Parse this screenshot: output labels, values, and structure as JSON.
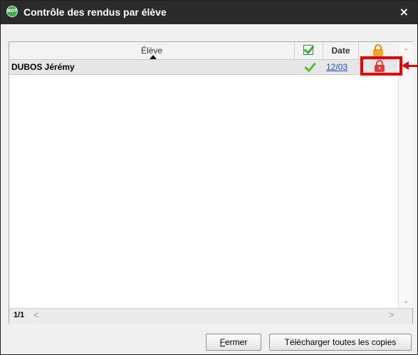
{
  "window": {
    "app_icon_text": "NOT",
    "title": "Contrôle des rendus par élève",
    "close_symbol": "×"
  },
  "grid": {
    "columns": {
      "eleve": "Élève",
      "check_icon": "checkbox-checked-icon",
      "date": "Date",
      "lock_icon": "lock-icon"
    },
    "rows": [
      {
        "eleve": "DUBOS Jérémy",
        "status_icon": "green-check-icon",
        "date": "12/03",
        "lock_icon": "red-lock-icon"
      }
    ],
    "scroll_up": "⌃",
    "scroll_down": "⌄"
  },
  "pager": {
    "count": "1/1",
    "left": "<",
    "right": ">"
  },
  "buttons": {
    "close_accel": "F",
    "close_rest": "ermer",
    "download": "Télécharger toutes les copies"
  },
  "annotation": {
    "color": "#e00000"
  }
}
